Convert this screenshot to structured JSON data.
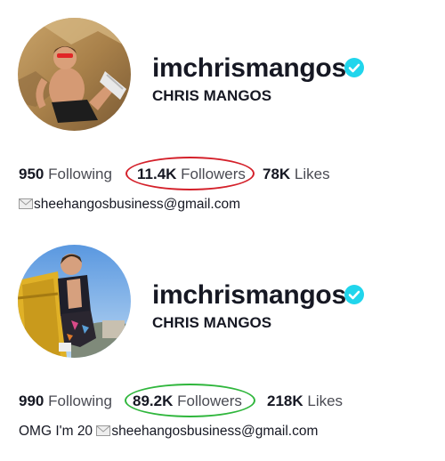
{
  "profiles": [
    {
      "username": "imchrismangos",
      "display_name": "CHRIS MANGOS",
      "following_count": "950",
      "following_label": "Following",
      "followers_count": "11.4K",
      "followers_label": "Followers",
      "likes_count": "78K",
      "likes_label": "Likes",
      "bio_prefix": "",
      "bio_email": "sheehangosbusiness@gmail.com",
      "highlight_color": "#d4202a"
    },
    {
      "username": "imchrismangos",
      "display_name": "CHRIS MANGOS",
      "following_count": "990",
      "following_label": "Following",
      "followers_count": "89.2K",
      "followers_label": "Followers",
      "likes_count": "218K",
      "likes_label": "Likes",
      "bio_prefix": "OMG I'm 20 ",
      "bio_email": "sheehangosbusiness@gmail.com",
      "highlight_color": "#2fb63c"
    }
  ],
  "colors": {
    "verified_badge": "#20d5ec",
    "text_primary": "#161823",
    "text_secondary": "#4a4b53"
  },
  "icons": [
    "verified-badge-icon",
    "envelope-icon"
  ]
}
